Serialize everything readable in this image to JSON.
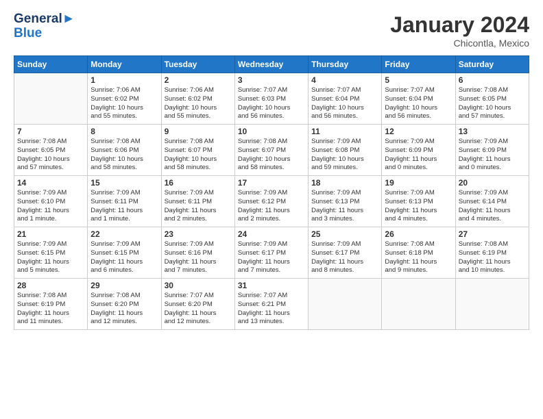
{
  "header": {
    "logo_line1": "General",
    "logo_line2": "Blue",
    "month": "January 2024",
    "location": "Chicontla, Mexico"
  },
  "days_of_week": [
    "Sunday",
    "Monday",
    "Tuesday",
    "Wednesday",
    "Thursday",
    "Friday",
    "Saturday"
  ],
  "weeks": [
    [
      {
        "num": "",
        "info": ""
      },
      {
        "num": "1",
        "info": "Sunrise: 7:06 AM\nSunset: 6:02 PM\nDaylight: 10 hours\nand 55 minutes."
      },
      {
        "num": "2",
        "info": "Sunrise: 7:06 AM\nSunset: 6:02 PM\nDaylight: 10 hours\nand 55 minutes."
      },
      {
        "num": "3",
        "info": "Sunrise: 7:07 AM\nSunset: 6:03 PM\nDaylight: 10 hours\nand 56 minutes."
      },
      {
        "num": "4",
        "info": "Sunrise: 7:07 AM\nSunset: 6:04 PM\nDaylight: 10 hours\nand 56 minutes."
      },
      {
        "num": "5",
        "info": "Sunrise: 7:07 AM\nSunset: 6:04 PM\nDaylight: 10 hours\nand 56 minutes."
      },
      {
        "num": "6",
        "info": "Sunrise: 7:08 AM\nSunset: 6:05 PM\nDaylight: 10 hours\nand 57 minutes."
      }
    ],
    [
      {
        "num": "7",
        "info": "Sunrise: 7:08 AM\nSunset: 6:05 PM\nDaylight: 10 hours\nand 57 minutes."
      },
      {
        "num": "8",
        "info": "Sunrise: 7:08 AM\nSunset: 6:06 PM\nDaylight: 10 hours\nand 58 minutes."
      },
      {
        "num": "9",
        "info": "Sunrise: 7:08 AM\nSunset: 6:07 PM\nDaylight: 10 hours\nand 58 minutes."
      },
      {
        "num": "10",
        "info": "Sunrise: 7:08 AM\nSunset: 6:07 PM\nDaylight: 10 hours\nand 58 minutes."
      },
      {
        "num": "11",
        "info": "Sunrise: 7:09 AM\nSunset: 6:08 PM\nDaylight: 10 hours\nand 59 minutes."
      },
      {
        "num": "12",
        "info": "Sunrise: 7:09 AM\nSunset: 6:09 PM\nDaylight: 11 hours\nand 0 minutes."
      },
      {
        "num": "13",
        "info": "Sunrise: 7:09 AM\nSunset: 6:09 PM\nDaylight: 11 hours\nand 0 minutes."
      }
    ],
    [
      {
        "num": "14",
        "info": "Sunrise: 7:09 AM\nSunset: 6:10 PM\nDaylight: 11 hours\nand 1 minute."
      },
      {
        "num": "15",
        "info": "Sunrise: 7:09 AM\nSunset: 6:11 PM\nDaylight: 11 hours\nand 1 minute."
      },
      {
        "num": "16",
        "info": "Sunrise: 7:09 AM\nSunset: 6:11 PM\nDaylight: 11 hours\nand 2 minutes."
      },
      {
        "num": "17",
        "info": "Sunrise: 7:09 AM\nSunset: 6:12 PM\nDaylight: 11 hours\nand 2 minutes."
      },
      {
        "num": "18",
        "info": "Sunrise: 7:09 AM\nSunset: 6:13 PM\nDaylight: 11 hours\nand 3 minutes."
      },
      {
        "num": "19",
        "info": "Sunrise: 7:09 AM\nSunset: 6:13 PM\nDaylight: 11 hours\nand 4 minutes."
      },
      {
        "num": "20",
        "info": "Sunrise: 7:09 AM\nSunset: 6:14 PM\nDaylight: 11 hours\nand 4 minutes."
      }
    ],
    [
      {
        "num": "21",
        "info": "Sunrise: 7:09 AM\nSunset: 6:15 PM\nDaylight: 11 hours\nand 5 minutes."
      },
      {
        "num": "22",
        "info": "Sunrise: 7:09 AM\nSunset: 6:15 PM\nDaylight: 11 hours\nand 6 minutes."
      },
      {
        "num": "23",
        "info": "Sunrise: 7:09 AM\nSunset: 6:16 PM\nDaylight: 11 hours\nand 7 minutes."
      },
      {
        "num": "24",
        "info": "Sunrise: 7:09 AM\nSunset: 6:17 PM\nDaylight: 11 hours\nand 7 minutes."
      },
      {
        "num": "25",
        "info": "Sunrise: 7:09 AM\nSunset: 6:17 PM\nDaylight: 11 hours\nand 8 minutes."
      },
      {
        "num": "26",
        "info": "Sunrise: 7:08 AM\nSunset: 6:18 PM\nDaylight: 11 hours\nand 9 minutes."
      },
      {
        "num": "27",
        "info": "Sunrise: 7:08 AM\nSunset: 6:19 PM\nDaylight: 11 hours\nand 10 minutes."
      }
    ],
    [
      {
        "num": "28",
        "info": "Sunrise: 7:08 AM\nSunset: 6:19 PM\nDaylight: 11 hours\nand 11 minutes."
      },
      {
        "num": "29",
        "info": "Sunrise: 7:08 AM\nSunset: 6:20 PM\nDaylight: 11 hours\nand 12 minutes."
      },
      {
        "num": "30",
        "info": "Sunrise: 7:07 AM\nSunset: 6:20 PM\nDaylight: 11 hours\nand 12 minutes."
      },
      {
        "num": "31",
        "info": "Sunrise: 7:07 AM\nSunset: 6:21 PM\nDaylight: 11 hours\nand 13 minutes."
      },
      {
        "num": "",
        "info": ""
      },
      {
        "num": "",
        "info": ""
      },
      {
        "num": "",
        "info": ""
      }
    ]
  ]
}
